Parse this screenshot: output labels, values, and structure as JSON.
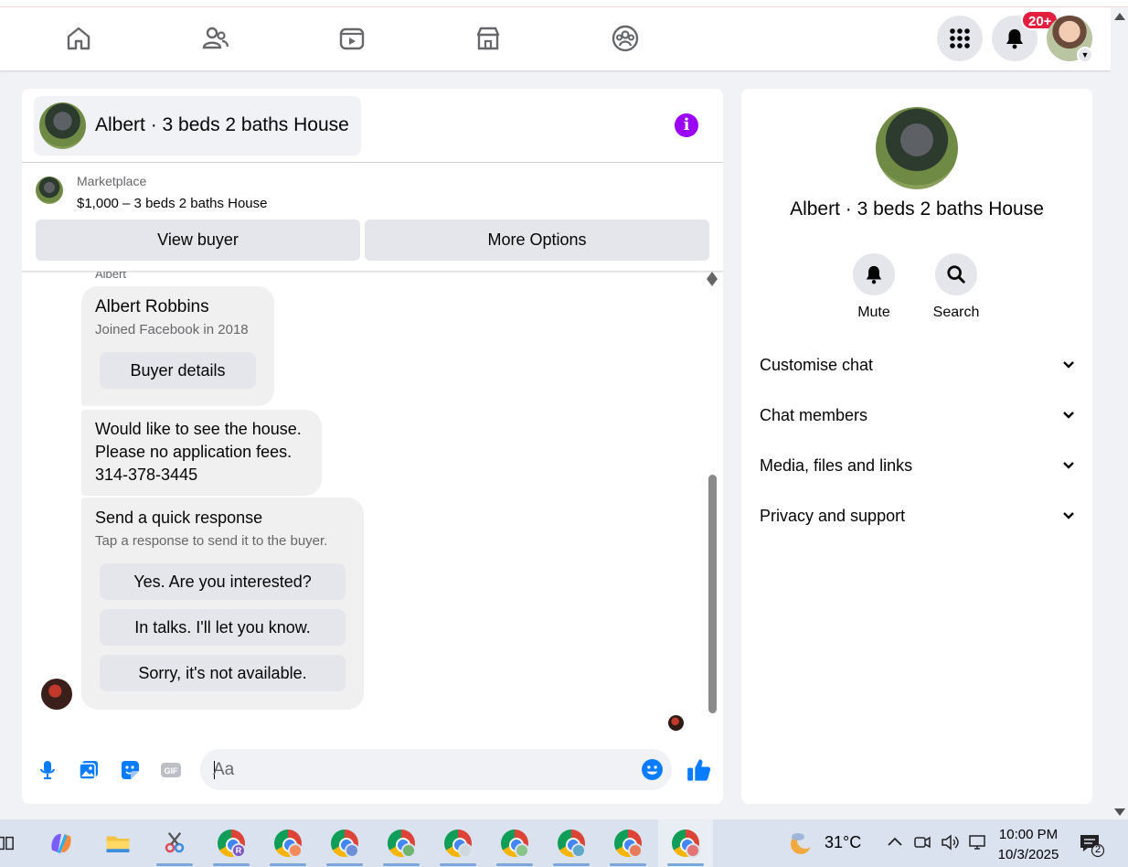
{
  "nav": {
    "icons": [
      "home-icon",
      "friends-icon",
      "video-icon",
      "marketplace-icon",
      "groups-icon"
    ],
    "notification_badge": "20+"
  },
  "chat": {
    "title": "Albert · 3 beds 2 baths House",
    "marketplace_label": "Marketplace",
    "listing": "$1,000 – 3 beds 2 baths House",
    "view_buyer": "View buyer",
    "more_options": "More Options",
    "sender_label": "Albert",
    "profile_card": {
      "name": "Albert Robbins",
      "joined": "Joined Facebook in 2018",
      "button": "Buyer details"
    },
    "message_lines": [
      "Would like to see the house.",
      "Please no application fees.",
      "314-378-3445"
    ],
    "quick_response": {
      "title": "Send a quick response",
      "subtitle": "Tap a response to send it to the buyer.",
      "options": [
        "Yes. Are you interested?",
        "In talks. I'll let you know.",
        "Sorry, it's not available."
      ]
    },
    "composer": {
      "placeholder": "Aa",
      "gif_label": "GIF"
    }
  },
  "info_panel": {
    "title": "Albert · 3 beds 2 baths House",
    "actions": [
      {
        "label": "Mute",
        "icon": "bell-icon"
      },
      {
        "label": "Search",
        "icon": "search-icon"
      }
    ],
    "sections": [
      "Customise chat",
      "Chat members",
      "Media, files and links",
      "Privacy and support"
    ]
  },
  "taskbar": {
    "temperature": "31°C",
    "time": "10:00 PM",
    "date": "10/3/2025",
    "notifications": "2",
    "profile_letter": "R"
  },
  "colors": {
    "accent_purple": "#9b00ff",
    "messenger_blue": "#0a7cff",
    "badge_red": "#e41e3f"
  }
}
